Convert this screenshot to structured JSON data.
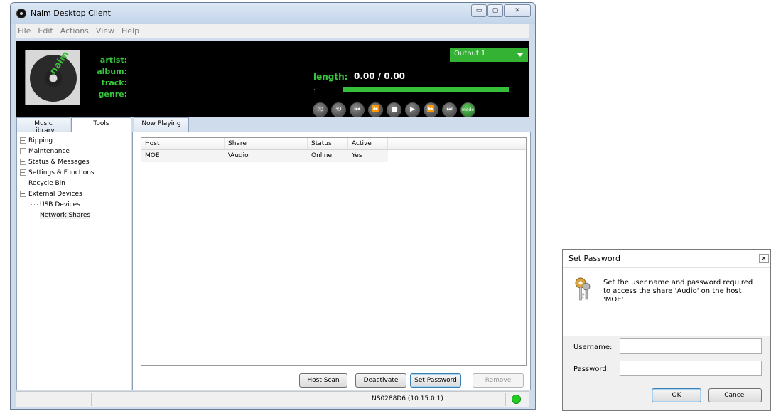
{
  "window": {
    "title": "Naim Desktop Client",
    "caption_buttons": {
      "minimize": "▭",
      "maximize": "▢",
      "close": "✕"
    }
  },
  "menu": [
    "File",
    "Edit",
    "Actions",
    "View",
    "Help"
  ],
  "player": {
    "art_logo": "naim",
    "labels": {
      "artist": "artist:",
      "album": "album:",
      "track": "track:",
      "genre": "genre:"
    },
    "length_label": "length:",
    "length_value": "0.00 / 0.00",
    "output": "Output 1",
    "position_marker": ":",
    "progress": 1.0,
    "controls": [
      {
        "name": "shuffle-icon",
        "glyph": "⤨"
      },
      {
        "name": "repeat-icon",
        "glyph": "⟲"
      },
      {
        "name": "skip-start-icon",
        "glyph": "⏮"
      },
      {
        "name": "rewind-icon",
        "glyph": "⏪"
      },
      {
        "name": "stop-icon",
        "glyph": "■"
      },
      {
        "name": "play-icon",
        "glyph": "▶"
      },
      {
        "name": "fast-forward-icon",
        "glyph": "⏩"
      },
      {
        "name": "skip-end-icon",
        "glyph": "⏭"
      },
      {
        "name": "mode-icon",
        "glyph": "mode"
      }
    ],
    "colors": {
      "accent": "#35c43a",
      "background": "#000000"
    }
  },
  "tabs": {
    "music_library": "Music Library",
    "tools": "Tools",
    "now_playing": "Now Playing"
  },
  "tree": {
    "ripping": "Ripping",
    "maintenance": "Maintenance",
    "status_messages": "Status & Messages",
    "settings_functions": "Settings & Functions",
    "recycle_bin": "Recycle Bin",
    "external_devices": "External Devices",
    "usb_devices": "USB Devices",
    "network_shares": "Network Shares",
    "expand_glyph": "+",
    "collapse_glyph": "−"
  },
  "table": {
    "headers": [
      "Host",
      "Share",
      "Status",
      "Active"
    ],
    "rows": [
      [
        "MOE",
        "\\Audio",
        "Online",
        "Yes"
      ]
    ]
  },
  "buttons": {
    "host_scan": "Host Scan",
    "deactivate": "Deactivate",
    "set_password": "Set Password",
    "remove": "Remove"
  },
  "status": {
    "text": "NS0288D6 (10.15.0.1)",
    "indicator_color": "#22cc22"
  },
  "dialog": {
    "title": "Set Password",
    "close": "✕",
    "message": "Set the user name and password required to access  the share 'Audio' on the host 'MOE'",
    "username_label": "Username:",
    "password_label": "Password:",
    "username_value": "",
    "password_value": "",
    "ok": "OK",
    "cancel": "Cancel"
  }
}
